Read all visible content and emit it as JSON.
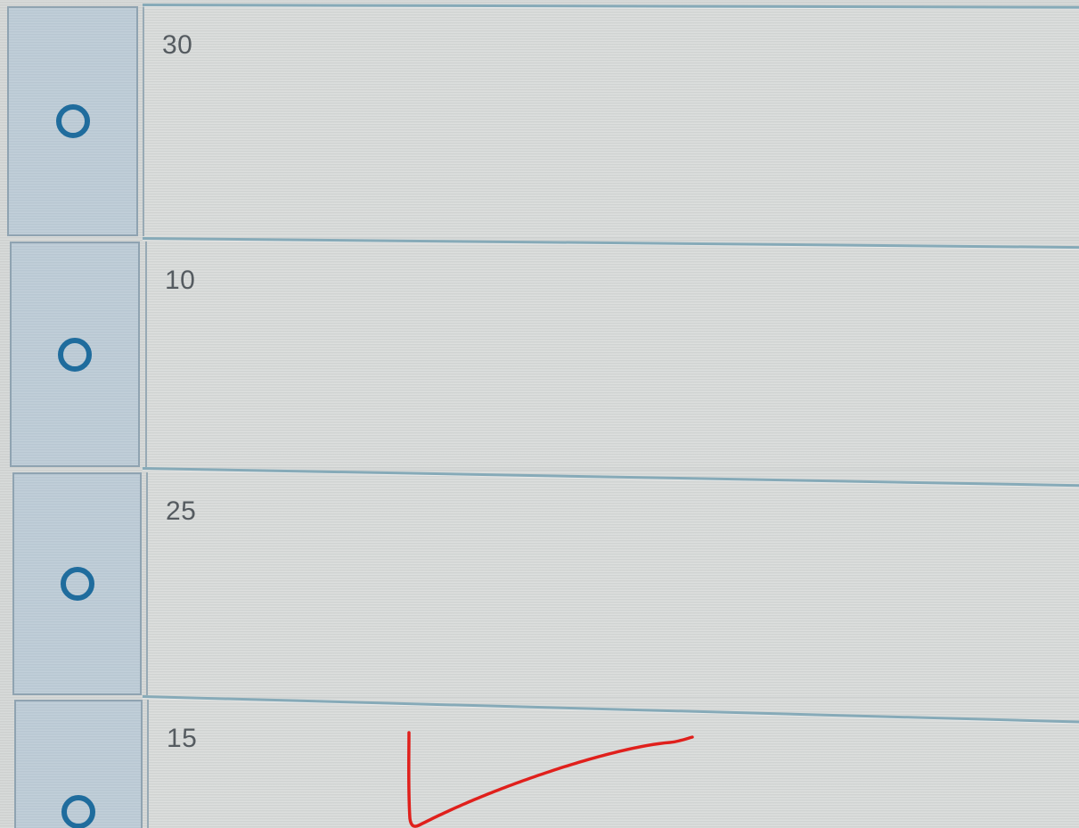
{
  "options": [
    {
      "label": "30"
    },
    {
      "label": "10"
    },
    {
      "label": "25"
    },
    {
      "label": "15"
    }
  ],
  "colors": {
    "radio": "#1f6c9d",
    "row_border": "#86aab8",
    "annotation": "#e0201c"
  },
  "icons": {
    "radio": "radio-unchecked-icon"
  }
}
